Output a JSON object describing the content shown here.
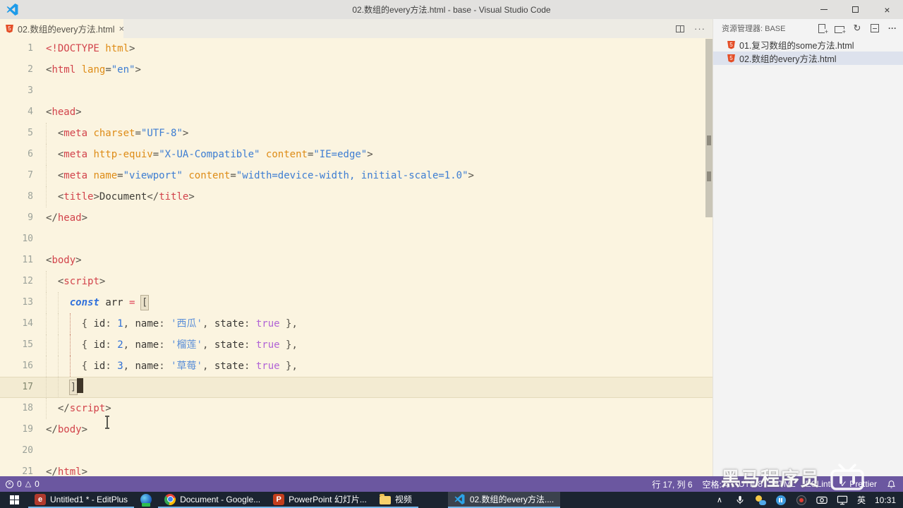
{
  "colors": {
    "editor_bg": "#FBF4E0",
    "current_line": "#F3EBD2",
    "statusbar_bg": "#6B57A0",
    "taskbar_bg": "#1B2430",
    "selected_row": "#DDE2ED",
    "tag_red": "#D2434B",
    "attr_orange": "#DE8C17",
    "string_blue": "#3D7DD2",
    "bool_purple": "#B163D6",
    "taskbar_underline": "#76B9ED"
  },
  "title_bar": {
    "title": "02.数组的every方法.html - base - Visual Studio Code",
    "close_glyph": "×"
  },
  "tab_bar": {
    "active_tab": {
      "label": "02.数组的every方法.html",
      "close_glyph": "×"
    }
  },
  "editor": {
    "current_line": 17,
    "cursor_position": {
      "line": 17,
      "column": 6
    },
    "lines": [
      {
        "num": 1,
        "tokens": [
          [
            "tag",
            "<!DOCTYPE"
          ],
          [
            "pln",
            " "
          ],
          [
            "attr",
            "html"
          ],
          [
            "pun",
            ">"
          ]
        ]
      },
      {
        "num": 2,
        "tokens": [
          [
            "pun",
            "<"
          ],
          [
            "tag",
            "html"
          ],
          [
            "pln",
            " "
          ],
          [
            "attr",
            "lang"
          ],
          [
            "pun",
            "="
          ],
          [
            "str",
            "\"en\""
          ],
          [
            "pun",
            ">"
          ]
        ]
      },
      {
        "num": 3,
        "tokens": []
      },
      {
        "num": 4,
        "tokens": [
          [
            "pun",
            "<"
          ],
          [
            "tag",
            "head"
          ],
          [
            "pun",
            ">"
          ]
        ]
      },
      {
        "num": 5,
        "tokens": [
          [
            "pln",
            "  "
          ],
          [
            "pun",
            "<"
          ],
          [
            "tag",
            "meta"
          ],
          [
            "pln",
            " "
          ],
          [
            "attr",
            "charset"
          ],
          [
            "pun",
            "="
          ],
          [
            "str",
            "\"UTF-8\""
          ],
          [
            "pun",
            ">"
          ]
        ]
      },
      {
        "num": 6,
        "tokens": [
          [
            "pln",
            "  "
          ],
          [
            "pun",
            "<"
          ],
          [
            "tag",
            "meta"
          ],
          [
            "pln",
            " "
          ],
          [
            "attr",
            "http-equiv"
          ],
          [
            "pun",
            "="
          ],
          [
            "str",
            "\"X-UA-Compatible\""
          ],
          [
            "pln",
            " "
          ],
          [
            "attr",
            "content"
          ],
          [
            "pun",
            "="
          ],
          [
            "str",
            "\"IE=edge\""
          ],
          [
            "pun",
            ">"
          ]
        ]
      },
      {
        "num": 7,
        "tokens": [
          [
            "pln",
            "  "
          ],
          [
            "pun",
            "<"
          ],
          [
            "tag",
            "meta"
          ],
          [
            "pln",
            " "
          ],
          [
            "attr",
            "name"
          ],
          [
            "pun",
            "="
          ],
          [
            "str",
            "\"viewport\""
          ],
          [
            "pln",
            " "
          ],
          [
            "attr",
            "content"
          ],
          [
            "pun",
            "="
          ],
          [
            "str",
            "\"width=device-width, initial-scale=1.0\""
          ],
          [
            "pun",
            ">"
          ]
        ]
      },
      {
        "num": 8,
        "tokens": [
          [
            "pln",
            "  "
          ],
          [
            "pun",
            "<"
          ],
          [
            "tag",
            "title"
          ],
          [
            "pun",
            ">"
          ],
          [
            "txt",
            "Document"
          ],
          [
            "pun",
            "</"
          ],
          [
            "tag",
            "title"
          ],
          [
            "pun",
            ">"
          ]
        ]
      },
      {
        "num": 9,
        "tokens": [
          [
            "pun",
            "</"
          ],
          [
            "tag",
            "head"
          ],
          [
            "pun",
            ">"
          ]
        ]
      },
      {
        "num": 10,
        "tokens": []
      },
      {
        "num": 11,
        "tokens": [
          [
            "pun",
            "<"
          ],
          [
            "tag",
            "body"
          ],
          [
            "pun",
            ">"
          ]
        ]
      },
      {
        "num": 12,
        "tokens": [
          [
            "pln",
            "  "
          ],
          [
            "pun",
            "<"
          ],
          [
            "tag",
            "script"
          ],
          [
            "pun",
            ">"
          ]
        ]
      },
      {
        "num": 13,
        "tokens": [
          [
            "pln",
            "    "
          ],
          [
            "kw",
            "const"
          ],
          [
            "pln",
            " "
          ],
          [
            "var",
            "arr"
          ],
          [
            "pln",
            " "
          ],
          [
            "op",
            "="
          ],
          [
            "pln",
            " "
          ],
          [
            "brkt",
            "["
          ]
        ]
      },
      {
        "num": 14,
        "active_guide": 4,
        "tokens": [
          [
            "pln",
            "      "
          ],
          [
            "pun",
            "{"
          ],
          [
            "pln",
            " "
          ],
          [
            "key",
            "id"
          ],
          [
            "pun",
            ":"
          ],
          [
            "pln",
            " "
          ],
          [
            "num",
            "1"
          ],
          [
            "pun",
            ","
          ],
          [
            "pln",
            " "
          ],
          [
            "key",
            "name"
          ],
          [
            "pun",
            ":"
          ],
          [
            "pln",
            " "
          ],
          [
            "jstr",
            "'西瓜'"
          ],
          [
            "pun",
            ","
          ],
          [
            "pln",
            " "
          ],
          [
            "key",
            "state"
          ],
          [
            "pun",
            ":"
          ],
          [
            "pln",
            " "
          ],
          [
            "bool",
            "true"
          ],
          [
            "pln",
            " "
          ],
          [
            "pun",
            "},"
          ]
        ]
      },
      {
        "num": 15,
        "active_guide": 4,
        "tokens": [
          [
            "pln",
            "      "
          ],
          [
            "pun",
            "{"
          ],
          [
            "pln",
            " "
          ],
          [
            "key",
            "id"
          ],
          [
            "pun",
            ":"
          ],
          [
            "pln",
            " "
          ],
          [
            "num",
            "2"
          ],
          [
            "pun",
            ","
          ],
          [
            "pln",
            " "
          ],
          [
            "key",
            "name"
          ],
          [
            "pun",
            ":"
          ],
          [
            "pln",
            " "
          ],
          [
            "jstr",
            "'榴莲'"
          ],
          [
            "pun",
            ","
          ],
          [
            "pln",
            " "
          ],
          [
            "key",
            "state"
          ],
          [
            "pun",
            ":"
          ],
          [
            "pln",
            " "
          ],
          [
            "bool",
            "true"
          ],
          [
            "pln",
            " "
          ],
          [
            "pun",
            "},"
          ]
        ]
      },
      {
        "num": 16,
        "active_guide": 4,
        "tokens": [
          [
            "pln",
            "      "
          ],
          [
            "pun",
            "{"
          ],
          [
            "pln",
            " "
          ],
          [
            "key",
            "id"
          ],
          [
            "pun",
            ":"
          ],
          [
            "pln",
            " "
          ],
          [
            "num",
            "3"
          ],
          [
            "pun",
            ","
          ],
          [
            "pln",
            " "
          ],
          [
            "key",
            "name"
          ],
          [
            "pun",
            ":"
          ],
          [
            "pln",
            " "
          ],
          [
            "jstr",
            "'草莓'"
          ],
          [
            "pun",
            ","
          ],
          [
            "pln",
            " "
          ],
          [
            "key",
            "state"
          ],
          [
            "pun",
            ":"
          ],
          [
            "pln",
            " "
          ],
          [
            "bool",
            "true"
          ],
          [
            "pln",
            " "
          ],
          [
            "pun",
            "},"
          ]
        ]
      },
      {
        "num": 17,
        "tokens": [
          [
            "pln",
            "    "
          ],
          [
            "brkt",
            "]"
          ],
          [
            "cursor",
            ""
          ]
        ]
      },
      {
        "num": 18,
        "tokens": [
          [
            "pln",
            "  "
          ],
          [
            "pun",
            "</"
          ],
          [
            "tag",
            "script"
          ],
          [
            "pun",
            ">"
          ]
        ]
      },
      {
        "num": 19,
        "tokens": [
          [
            "pun",
            "</"
          ],
          [
            "tag",
            "body"
          ],
          [
            "pun",
            ">"
          ]
        ]
      },
      {
        "num": 20,
        "tokens": []
      },
      {
        "num": 21,
        "tokens": [
          [
            "pun",
            "</"
          ],
          [
            "tag",
            "html"
          ],
          [
            "pun",
            ">"
          ]
        ]
      }
    ]
  },
  "sidebar": {
    "header": "资源管理器: BASE",
    "actions": [
      {
        "name": "new-file"
      },
      {
        "name": "new-folder"
      },
      {
        "name": "refresh"
      },
      {
        "name": "collapse-all"
      },
      {
        "name": "more-actions"
      }
    ],
    "files": [
      {
        "name": "01.复习数组的some方法.html",
        "selected": false
      },
      {
        "name": "02.数组的every方法.html",
        "selected": true
      }
    ]
  },
  "status_bar": {
    "errors": "0",
    "warnings": "0",
    "items": [
      {
        "name": "cursor-position",
        "label": "行 17, 列 6"
      },
      {
        "name": "indentation",
        "label": "空格: 4"
      },
      {
        "name": "encoding",
        "label": "UTF-8"
      },
      {
        "name": "language-mode",
        "label": "HTML"
      },
      {
        "name": "eslint",
        "label": "ESLint"
      },
      {
        "name": "prettier",
        "label": "✓ Prettier"
      }
    ]
  },
  "watermark": {
    "text": "黑马程序员",
    "logo": "bilibili-tv"
  },
  "taskbar": {
    "buttons": [
      {
        "name": "editplus",
        "label": "Untitled1 * - EditPlus",
        "underline": true,
        "active": false,
        "gap": false
      },
      {
        "name": "edge",
        "label": "",
        "underline": false,
        "active": false,
        "gap": false
      },
      {
        "name": "chrome",
        "label": "Document - Google...",
        "underline": true,
        "active": false,
        "gap": false
      },
      {
        "name": "powerpoint",
        "label": "PowerPoint 幻灯片...",
        "underline": true,
        "active": false,
        "gap": false
      },
      {
        "name": "folder",
        "label": "视频",
        "underline": true,
        "active": false,
        "gap": false
      },
      {
        "name": "vscode",
        "label": "02.数组的every方法....",
        "underline": true,
        "active": true,
        "gap": true
      }
    ],
    "tray": [
      {
        "name": "chevron-up",
        "label": ""
      },
      {
        "name": "microphone",
        "label": ""
      },
      {
        "name": "weather",
        "label": ""
      },
      {
        "name": "pause",
        "label": ""
      },
      {
        "name": "record",
        "label": ""
      },
      {
        "name": "recorder",
        "label": ""
      },
      {
        "name": "monitor",
        "label": ""
      },
      {
        "name": "ime",
        "label": "英"
      },
      {
        "name": "clock",
        "label": "10:31"
      }
    ]
  }
}
